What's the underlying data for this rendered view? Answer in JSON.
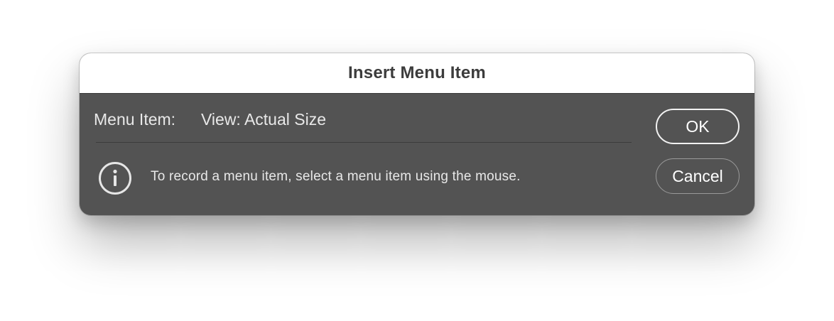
{
  "dialog": {
    "title": "Insert Menu Item",
    "menu_item_label": "Menu Item:",
    "menu_item_value": "View: Actual Size",
    "info_icon": "info-circle-icon",
    "info_text": "To record a menu item, select a menu item using the mouse.",
    "ok_label": "OK",
    "cancel_label": "Cancel"
  },
  "colors": {
    "dialog_body": "#535353",
    "titlebar": "#ffffff",
    "text": "#e8e8e8"
  }
}
